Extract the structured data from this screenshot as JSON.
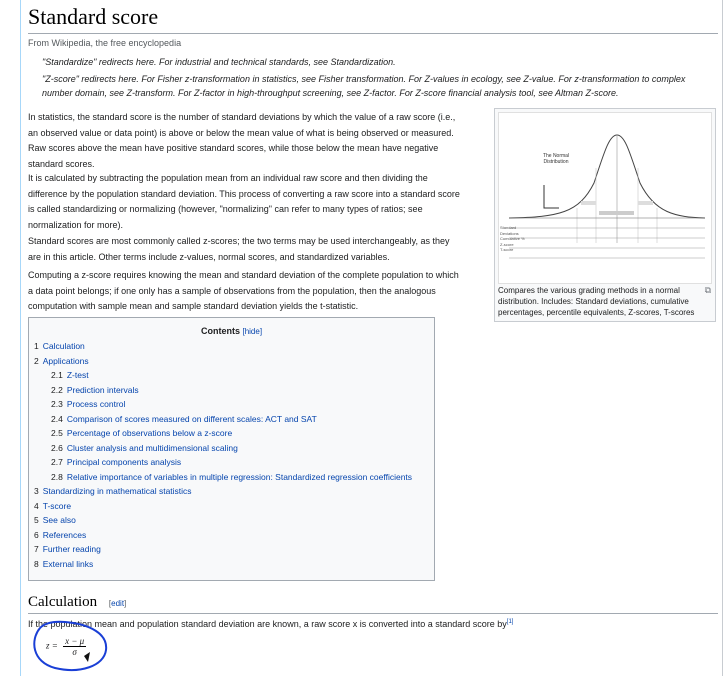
{
  "page": {
    "title": "Standard score",
    "from": "From Wikipedia, the free encyclopedia"
  },
  "hatnotes": [
    "\"Standardize\" redirects here. For industrial and technical standards, see Standardization.",
    "\"Z-score\" redirects here. For Fisher z-transformation in statistics, see Fisher transformation. For Z-values in ecology, see Z-value. For z-transformation to complex",
    "number domain, see Z-transform. For Z-factor in high-throughput screening, see Z-factor. For Z-score financial analysis tool, see Altman Z-score."
  ],
  "intro": {
    "p1": [
      "In statistics, the standard score is the number of standard deviations by which the value of a raw score (i.e.,",
      "an observed value or data point) is above or below the mean value of what is being observed or measured.",
      "Raw scores above the mean have positive standard scores, while those below the mean have negative",
      "standard scores."
    ],
    "p2": [
      "It is calculated by subtracting the population mean from an individual raw score and then dividing the",
      "difference by the population standard deviation. This process of converting a raw score into a standard score",
      "is called standardizing or normalizing (however, \"normalizing\" can refer to many types of ratios; see",
      "normalization for more)."
    ],
    "p3": [
      "Standard scores are most commonly called z-scores; the two terms may be used interchangeably, as they",
      "are in this article. Other terms include z-values, normal scores, and standardized variables."
    ],
    "p4": [
      "Computing a z-score requires knowing the mean and standard deviation of the complete population to which",
      "a data point belongs; if one only has a sample of observations from the population, then the analogous",
      "computation with sample mean and sample standard deviation yields the t-statistic."
    ]
  },
  "figure": {
    "label": "The Normal Distribution",
    "row_labels": [
      "Standard Deviations",
      "Cumulative %",
      "Z-score",
      "T-score"
    ],
    "caption": "Compares the various grading methods in a normal distribution. Includes: Standard deviations, cumulative percentages, percentile equivalents, Z-scores, T-scores"
  },
  "toc": {
    "title": "Contents",
    "hide": "[hide]",
    "items": [
      {
        "num": "1",
        "label": "Calculation",
        "level": 1
      },
      {
        "num": "2",
        "label": "Applications",
        "level": 1
      },
      {
        "num": "2.1",
        "label": "Z-test",
        "level": 2
      },
      {
        "num": "2.2",
        "label": "Prediction intervals",
        "level": 2
      },
      {
        "num": "2.3",
        "label": "Process control",
        "level": 2
      },
      {
        "num": "2.4",
        "label": "Comparison of scores measured on different scales: ACT and SAT",
        "level": 2
      },
      {
        "num": "2.5",
        "label": "Percentage of observations below a z-score",
        "level": 2
      },
      {
        "num": "2.6",
        "label": "Cluster analysis and multidimensional scaling",
        "level": 2
      },
      {
        "num": "2.7",
        "label": "Principal components analysis",
        "level": 2
      },
      {
        "num": "2.8",
        "label": "Relative importance of variables in multiple regression: Standardized regression coefficients",
        "level": 2
      },
      {
        "num": "3",
        "label": "Standardizing in mathematical statistics",
        "level": 1
      },
      {
        "num": "4",
        "label": "T-score",
        "level": 1
      },
      {
        "num": "5",
        "label": "See also",
        "level": 1
      },
      {
        "num": "6",
        "label": "References",
        "level": 1
      },
      {
        "num": "7",
        "label": "Further reading",
        "level": 1
      },
      {
        "num": "8",
        "label": "External links",
        "level": 1
      }
    ]
  },
  "section": {
    "heading": "Calculation",
    "edit": "edit",
    "text": "If the population mean and population standard deviation are known, a raw score x is converted into a standard score by",
    "ref": "[1]",
    "formula_lhs": "z =",
    "formula_num": "x − μ",
    "formula_den": "σ"
  },
  "colors": {
    "link": "#0645ad",
    "annotation": "#1a3fd6"
  }
}
